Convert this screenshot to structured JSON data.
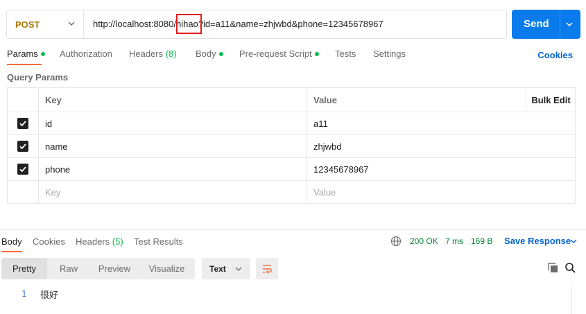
{
  "request": {
    "method": "POST",
    "url": "http://localhost:8080/nihao?id=a11&name=zhjwbd&phone=12345678967",
    "send_label": "Send"
  },
  "tabs": [
    {
      "label": "Params",
      "dot": true
    },
    {
      "label": "Authorization"
    },
    {
      "label": "Headers",
      "count": "(8)"
    },
    {
      "label": "Body",
      "dot": true
    },
    {
      "label": "Pre-request Script",
      "dot": true
    },
    {
      "label": "Tests"
    },
    {
      "label": "Settings"
    }
  ],
  "cookies_label": "Cookies",
  "query_params": {
    "title": "Query Params",
    "headers": {
      "key": "Key",
      "value": "Value",
      "bulk": "Bulk Edit"
    },
    "rows": [
      {
        "key": "id",
        "value": "a11",
        "checked": true
      },
      {
        "key": "name",
        "value": "zhjwbd",
        "checked": true
      },
      {
        "key": "phone",
        "value": "12345678967",
        "checked": true
      }
    ],
    "placeholder": {
      "key": "Key",
      "value": "Value"
    }
  },
  "response": {
    "tabs": [
      {
        "label": "Body"
      },
      {
        "label": "Cookies"
      },
      {
        "label": "Headers",
        "count": "(5)"
      },
      {
        "label": "Test Results"
      }
    ],
    "status": "200 OK",
    "time": "7 ms",
    "size": "169 B",
    "save_label": "Save Response",
    "views": [
      "Pretty",
      "Raw",
      "Preview",
      "Visualize"
    ],
    "format": "Text",
    "line_number": "1",
    "body": "很好"
  },
  "colors": {
    "accent_blue": "#097bed",
    "link_blue": "#0265d2",
    "method_post": "#ad7a03",
    "active_tab": "#f26b3a",
    "status_green": "#007f31",
    "highlight_red": "#e41b1b"
  },
  "icons": [
    "chevron-down-icon",
    "globe-icon",
    "wrap-icon",
    "copy-icon",
    "search-icon",
    "check-icon"
  ]
}
